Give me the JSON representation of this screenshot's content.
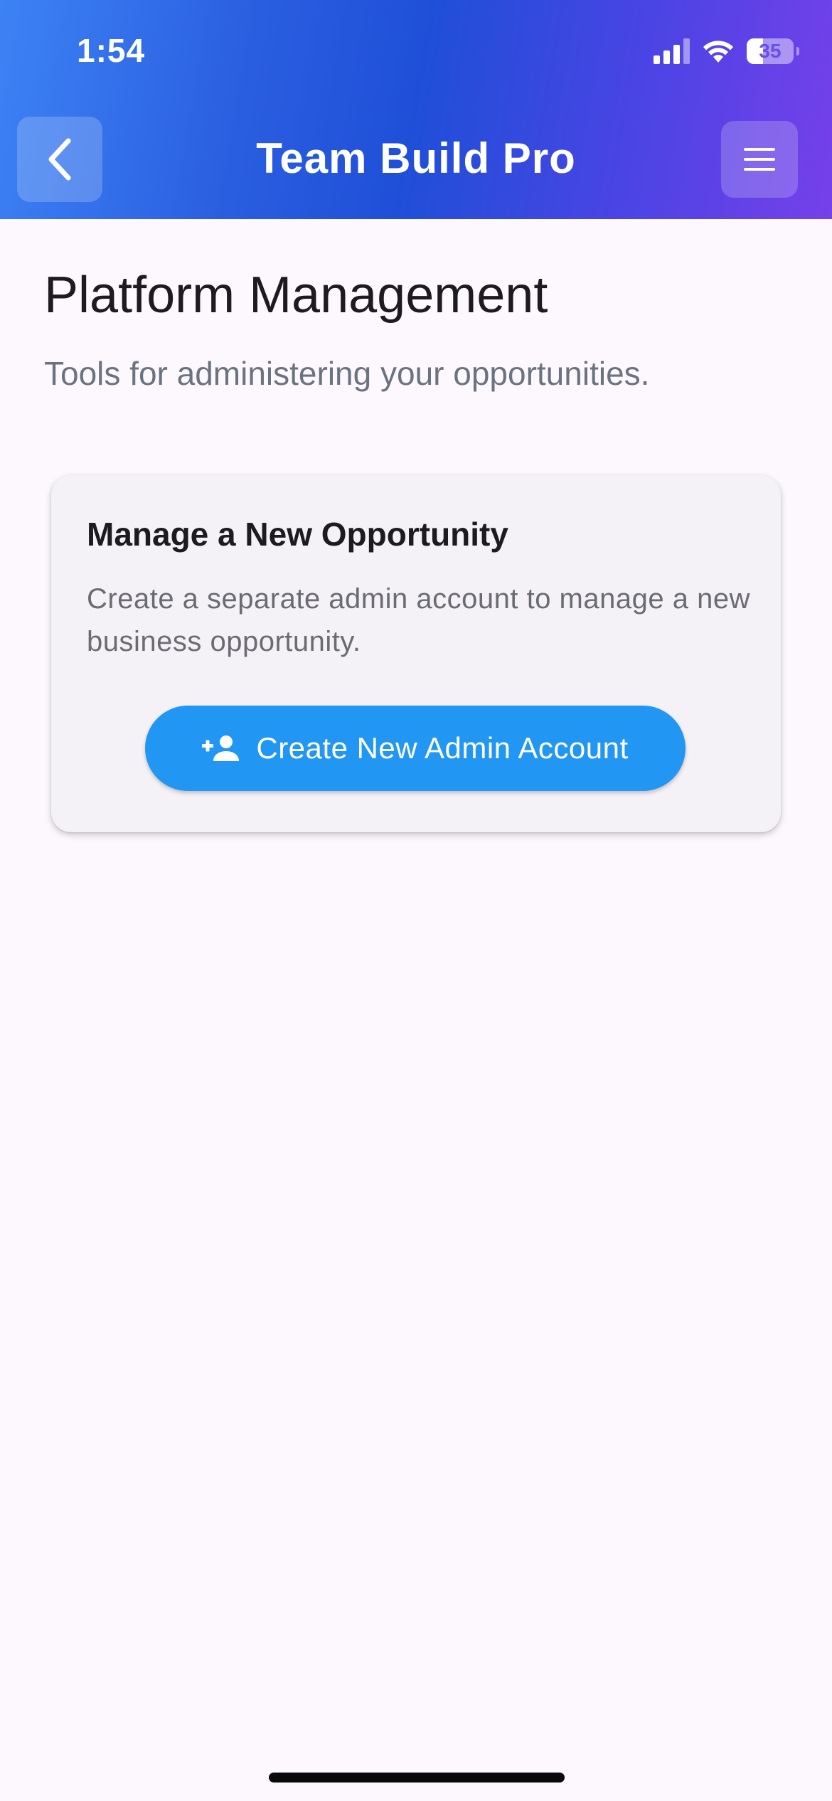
{
  "status_bar": {
    "time": "1:54",
    "battery_level": "35",
    "battery_fraction": 0.35,
    "icons": [
      "cellular-signal-icon",
      "wifi-icon",
      "battery-icon"
    ]
  },
  "header": {
    "title": "Team Build Pro",
    "back_icon": "chevron-left-icon",
    "menu_icon": "hamburger-menu-icon",
    "gradient_colors": [
      "#3d82f5",
      "#1f4fd8",
      "#7640ea"
    ]
  },
  "page": {
    "title": "Platform Management",
    "subtitle": "Tools for administering your opportunities."
  },
  "card": {
    "title": "Manage a New Opportunity",
    "description": "Create a separate admin account to manage a new business opportunity.",
    "button_label": "Create New Admin Account",
    "button_icon": "person-add-icon",
    "button_color": "#2196f3"
  }
}
